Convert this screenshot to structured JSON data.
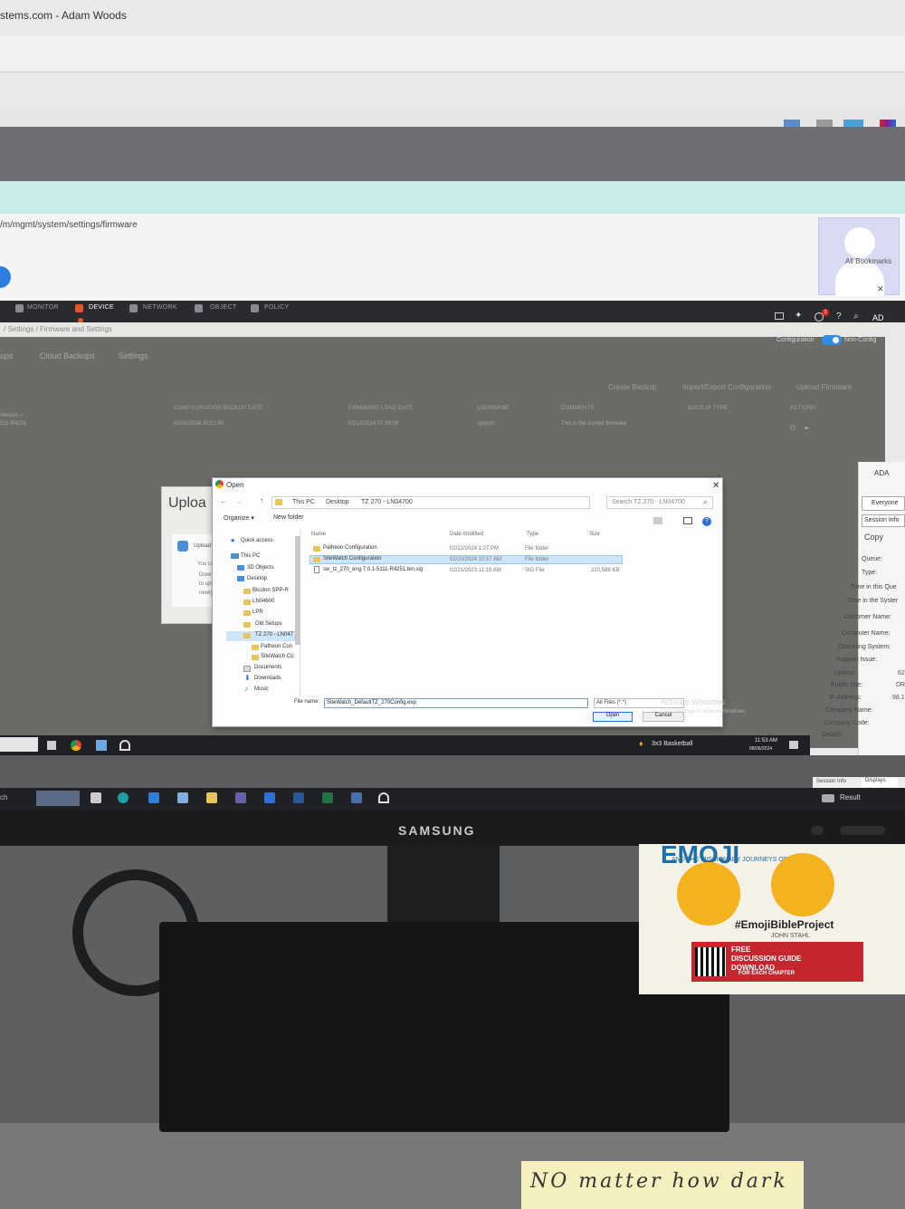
{
  "browser": {
    "tab_title": "stems.com - Adam Woods",
    "url": "/m/mgmt/system/settings/firmware",
    "bookmarks": "All Bookmarks"
  },
  "app_nav": {
    "items": [
      "MONITOR",
      "DEVICE",
      "NETWORK",
      "OBJECT",
      "POLICY"
    ],
    "user_initials": "AD",
    "notification_count": "2"
  },
  "breadcrumb": "/ Settings / Firmware and Settings",
  "configuration": {
    "label": "Configuration",
    "mode": "Non-Config"
  },
  "subtabs": [
    "ups",
    "Cloud Backups",
    "Settings"
  ],
  "actions": {
    "create_backup": "Create Backup",
    "import_export": "Import/Export Configuration",
    "upload_firmware": "Upload Firmware"
  },
  "firmware_table": {
    "headers": [
      "CONFIGURATION BACKUP DATE",
      "FIRMWARE LOAD DATE",
      "USERNAME",
      "COMMENTS",
      "BACKUP TYPE",
      "ACTIONS"
    ],
    "row": {
      "version": "Version ✓",
      "version_id": "511-R4251",
      "backup_date": "02/01/2024 20:51:50",
      "load_date": "02/12/2024 07:39:09",
      "username": "system",
      "comment": "This is the current firmware"
    }
  },
  "upload_modal": {
    "title": "Uploa",
    "line1": "Upload",
    "line2": "You ca",
    "line3": "Down",
    "line4": "to uplo",
    "line5": "newly"
  },
  "open_dialog": {
    "title": "Open",
    "close": "✕",
    "path": [
      "This PC",
      "Desktop",
      "TZ 270 - LN04700"
    ],
    "search_placeholder": "Search TZ 270 - LN04700",
    "organize": "Organize ▾",
    "new_folder": "New folder",
    "nav_items": [
      "Quick access",
      "This PC",
      "3D Objects",
      "Desktop",
      "Bicolon SPP-R",
      "LN04600",
      "LPR",
      "Old Setups",
      "TZ 270 - LN047",
      "Patheon Con",
      "SiteWatch Co",
      "Documents",
      "Downloads",
      "Music"
    ],
    "columns": [
      "Name",
      "Date modified",
      "Type",
      "Size"
    ],
    "files": [
      {
        "name": "Patheon Configuration",
        "date": "02/12/2024 1:27 PM",
        "type": "File folder",
        "size": ""
      },
      {
        "name": "SiteWatch Configuration",
        "date": "02/20/2024 10:57 AM",
        "type": "File folder",
        "size": ""
      },
      {
        "name": "sw_tz_270_eng.7.0.1-5111-R4251.bin.sig",
        "date": "02/21/2023 11:19 AM",
        "type": "SIG File",
        "size": "220,588 KB"
      }
    ],
    "file_name_label": "File name:",
    "file_name_value": "SiteWatch_DefaultTZ_270Config.exp",
    "filter": "All Files (*.*)",
    "open_label": "Open",
    "cancel_label": "Cancel",
    "watermark": "Activate Windows",
    "watermark_sub": "Go to Settings to activate Windows."
  },
  "right_panel": {
    "user": "ADA",
    "everyone": "Everyone",
    "session_info": "Session Info",
    "copy": "Copy",
    "fields": [
      "Queue:",
      "Type:",
      "Time in this Que",
      "Time in the Syster",
      "Customer Name:",
      "Computer Name:",
      "Operating System:",
      "Support Issue:",
      "Uptime:",
      "Public Site:",
      "IP Address:",
      "Company Name:",
      "Company Code:",
      "Details:"
    ],
    "values": [
      "62",
      "DR",
      "98.1"
    ],
    "tab_session_info": "Session Info",
    "tab_displays": "Displays"
  },
  "inner_taskbar": {
    "weather": "3x3 Basketball",
    "time": "11:53 AM",
    "date": "08/06/2024"
  },
  "local_taskbar": {
    "search_text": "ch",
    "result": "Result"
  },
  "monitor_brand": "SAMSUNG",
  "book": {
    "title": "EMOJI",
    "subtitle": "AND THE MISSIONARY JOURNEYS OF PAUL",
    "tag": "#EmojiBibleProject",
    "author": "JOHN STAHL",
    "promo1": "FREE",
    "promo2": "DISCUSSION GUIDE",
    "promo3": "DOWNLOAD",
    "promo4": "FOR EACH CHAPTER"
  },
  "sticky_note": "NO matter how dark"
}
